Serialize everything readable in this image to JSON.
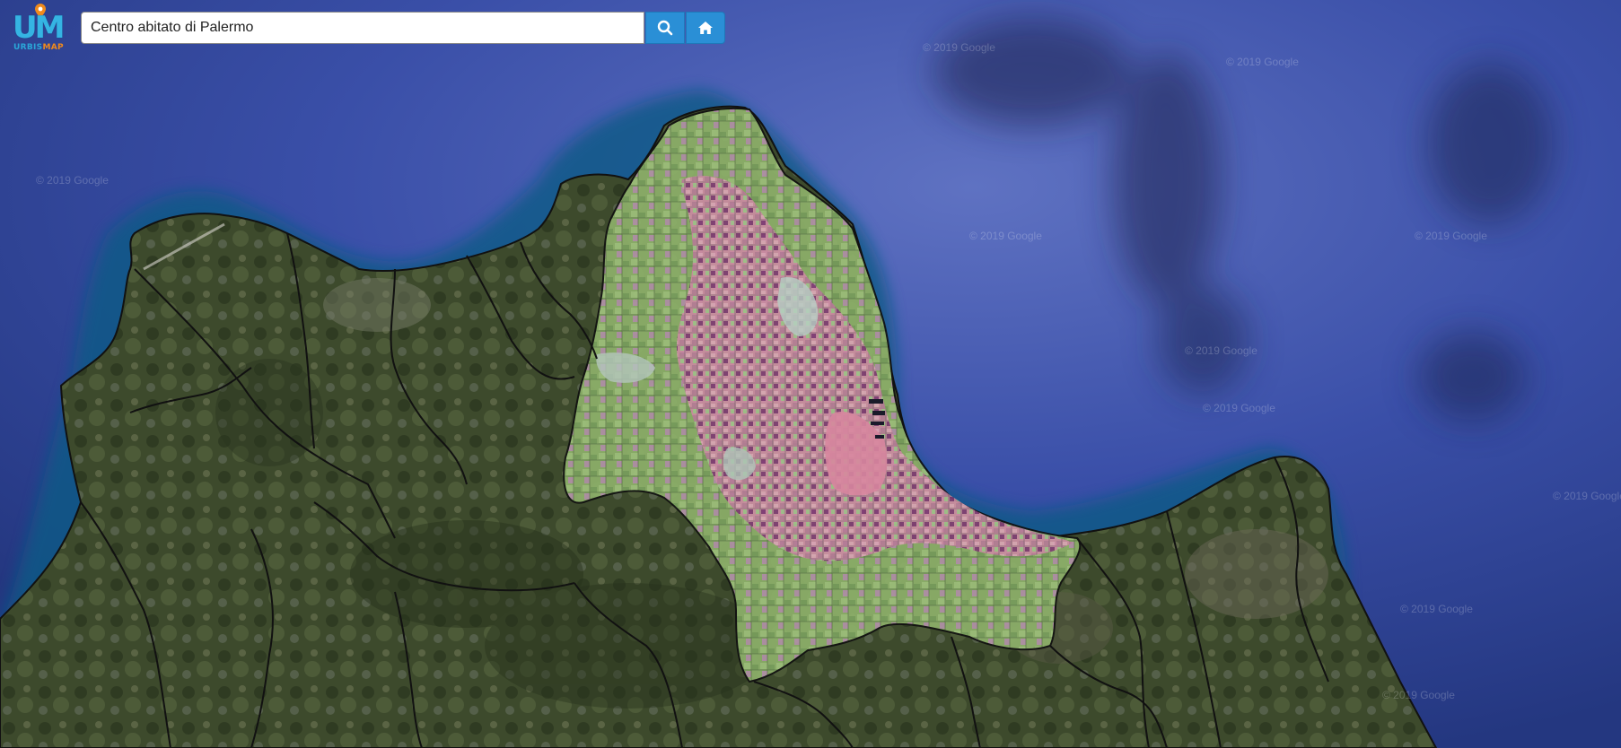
{
  "app": {
    "logo_text": "UM",
    "logo_sub_urbis": "URBIS",
    "logo_sub_map": "MAP"
  },
  "search": {
    "value": "Centro abitato di Palermo",
    "button_icon": "search-icon",
    "home_icon": "home-icon"
  },
  "map": {
    "attribution": "© 2019 Google",
    "colors": {
      "sea": "#2c3f95",
      "sea_deep": "#1e2b6e",
      "coast_water": "#0d4f7a",
      "land": "#3b4a2e",
      "highlight_green": "#8fb86a",
      "urban_pink": "#d98aa6",
      "urban_purple": "#7a2a6a",
      "border": "#111111",
      "accent": "#2a8fd6"
    }
  }
}
